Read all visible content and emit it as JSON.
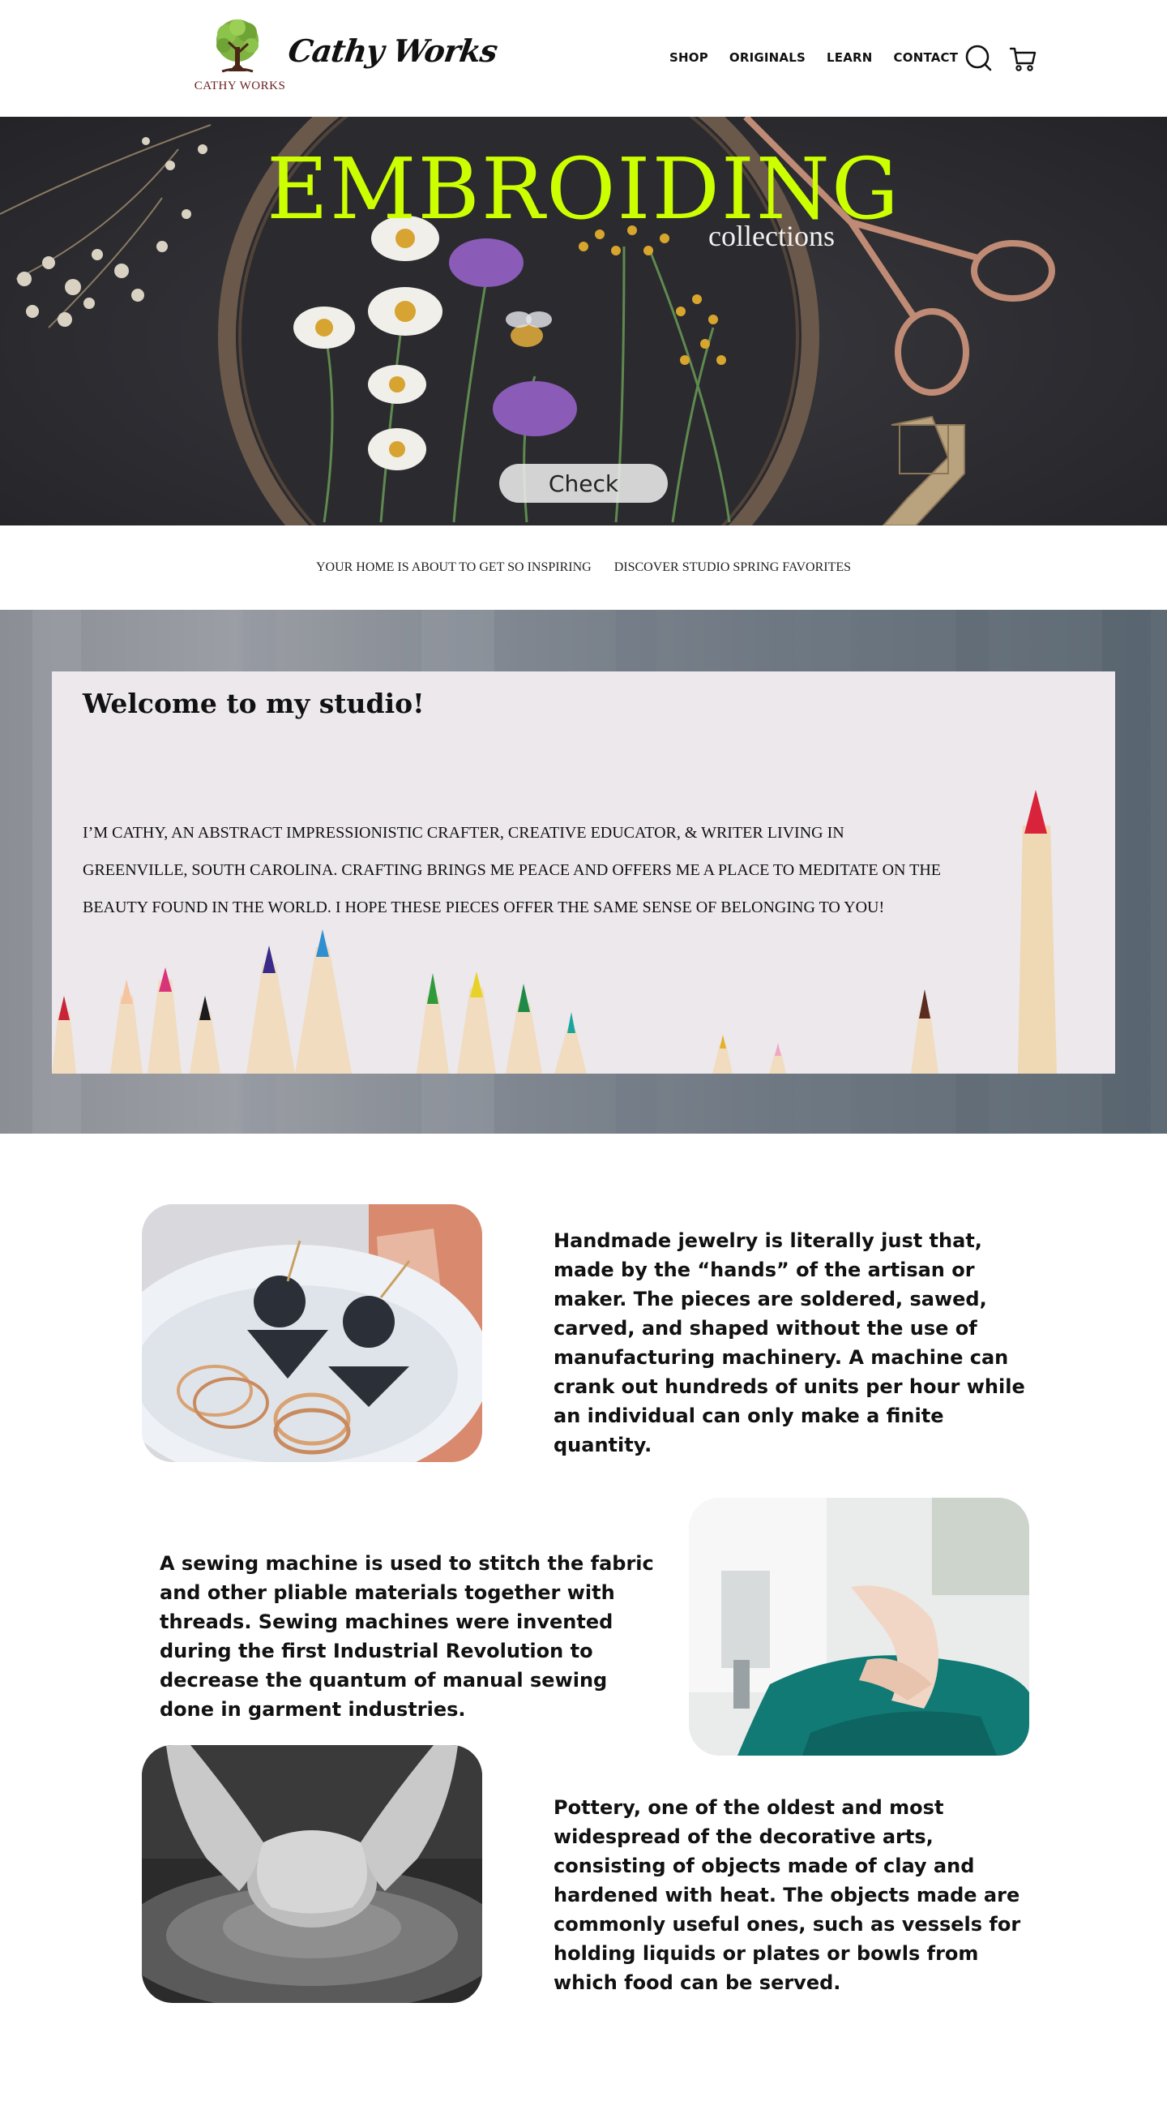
{
  "header": {
    "logo_caption": "CATHY WORKS",
    "brand_name": "Cathy Works",
    "nav": [
      "SHOP",
      "ORIGINALS",
      "LEARN",
      "CONTACT"
    ],
    "icons": [
      "search-icon",
      "cart-icon"
    ]
  },
  "hero": {
    "title": "EMBROIDING",
    "subtitle": "collections",
    "button_label": "Check",
    "title_color": "#ccff00"
  },
  "strip": {
    "links": [
      "YOUR HOME IS ABOUT TO GET SO INSPIRING",
      "DISCOVER STUDIO SPRING FAVORITES"
    ]
  },
  "studio": {
    "title": "Welcome to my studio!",
    "text": "I’M CATHY, AN ABSTRACT IMPRESSIONISTIC CRAFTER, CREATIVE EDUCATOR, & WRITER LIVING IN GREENVILLE, SOUTH CAROLINA. CRAFTING BRINGS ME PEACE AND OFFERS ME A PLACE TO MEDITATE ON THE BEAUTY FOUND IN THE WORLD. I HOPE THESE PIECES OFFER THE SAME SENSE OF BELONGING TO YOU!"
  },
  "features": [
    {
      "text": "Handmade jewelry is literally just that, made by the “hands” of the artisan or maker. The pieces are soldered, sawed, carved, and shaped without the use of manufacturing machinery. A machine can crank out hundreds of units per hour while an individual can only make a finite quantity."
    },
    {
      "text": "A sewing machine is used to stitch the fabric and other pliable materials together with threads. Sewing machines were invented during the first Industrial Revolution to decrease the quantum of manual sewing done in garment industries."
    },
    {
      "text": "Pottery, one of the oldest and most widespread of the decorative arts, consisting of objects made of clay and hardened with heat. The objects made are commonly useful ones, such as vessels for holding liquids or plates or bowls from which food can be served."
    }
  ]
}
